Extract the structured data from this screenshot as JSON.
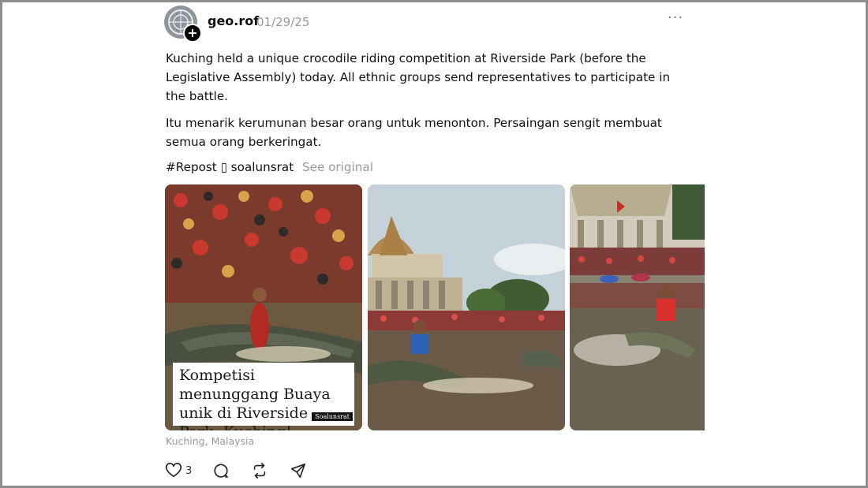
{
  "post": {
    "username": "geo.rof",
    "date": "01/29/25",
    "more_label": "···",
    "paragraph1": "Kuching held a unique crocodile riding competition at Riverside Park (before the Legislative Assembly) today. All ethnic groups send representatives to participate in the battle.",
    "paragraph2": "Itu menarik kerumunan besar orang untuk menonton. Persaingan sengit membuat semua orang berkeringat.",
    "tags": "#Repost ▯ soalunsrat",
    "see_original": "See original",
    "image1_caption": "Kompetisi menunggang Buaya unik di Riverside Park, Kuching!",
    "image1_brand": "Soalunsrat",
    "location": "Kuching, Malaysia"
  },
  "actions": {
    "like_count": "3"
  },
  "icons": {
    "avatar": "globe-avatar",
    "follow": "plus-icon",
    "more": "more-dots-icon",
    "like": "heart-icon",
    "reply": "comment-icon",
    "repost": "repost-icon",
    "share": "send-icon"
  }
}
